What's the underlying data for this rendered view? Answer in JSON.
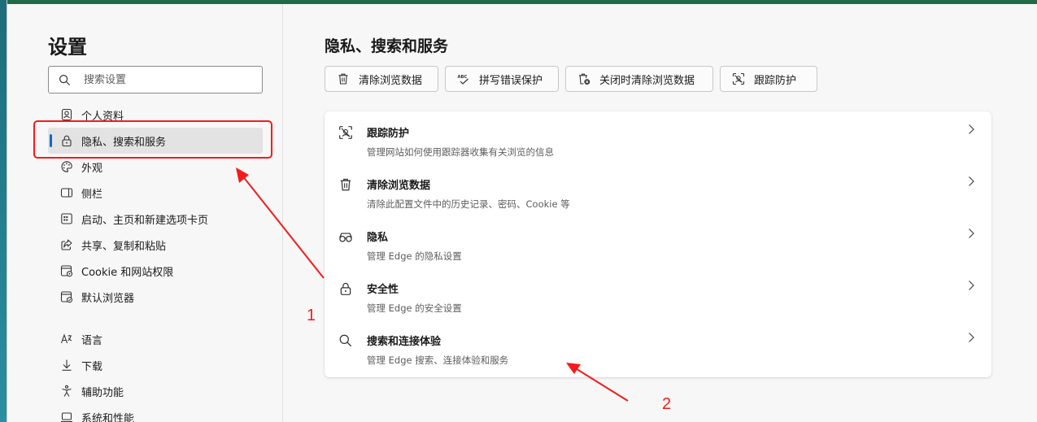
{
  "sidebar": {
    "title": "设置",
    "search_placeholder": "搜索设置",
    "items": [
      {
        "label": "个人资料",
        "icon": "profile-icon"
      },
      {
        "label": "隐私、搜索和服务",
        "icon": "lock-icon",
        "active": true
      },
      {
        "label": "外观",
        "icon": "palette-icon"
      },
      {
        "label": "侧栏",
        "icon": "sidebar-icon"
      },
      {
        "label": "启动、主页和新建选项卡页",
        "icon": "home-grid-icon"
      },
      {
        "label": "共享、复制和粘贴",
        "icon": "share-icon"
      },
      {
        "label": "Cookie 和网站权限",
        "icon": "cookie-icon"
      },
      {
        "label": "默认浏览器",
        "icon": "browser-icon"
      },
      {
        "label": "语言",
        "icon": "language-icon"
      },
      {
        "label": "下载",
        "icon": "download-icon"
      },
      {
        "label": "辅助功能",
        "icon": "accessibility-icon"
      },
      {
        "label": "系统和性能",
        "icon": "laptop-icon"
      }
    ]
  },
  "main": {
    "title": "隐私、搜索和服务",
    "quick_buttons": [
      {
        "label": "清除浏览数据",
        "icon": "trash-icon"
      },
      {
        "label": "拼写错误保护",
        "icon": "spellcheck-icon"
      },
      {
        "label": "关闭时清除浏览数据",
        "icon": "trash-clock-icon"
      },
      {
        "label": "跟踪防护",
        "icon": "tracking-icon"
      }
    ],
    "rows": [
      {
        "title": "跟踪防护",
        "desc": "管理网站如何使用跟踪器收集有关浏览的信息",
        "icon": "tracking-icon"
      },
      {
        "title": "清除浏览数据",
        "desc": "清除此配置文件中的历史记录、密码、Cookie 等",
        "icon": "trash-icon"
      },
      {
        "title": "隐私",
        "desc": "管理 Edge 的隐私设置",
        "icon": "glasses-icon"
      },
      {
        "title": "安全性",
        "desc": "管理 Edge 的安全设置",
        "icon": "lock-icon"
      },
      {
        "title": "搜索和连接体验",
        "desc": "管理 Edge 搜索、连接体验和服务",
        "icon": "search-icon"
      }
    ]
  },
  "annotations": {
    "label_1": "1",
    "label_2": "2",
    "color": "#f21c1c"
  },
  "colors": {
    "accent": "#0f6cbd",
    "annotation": "#f21c1c"
  }
}
